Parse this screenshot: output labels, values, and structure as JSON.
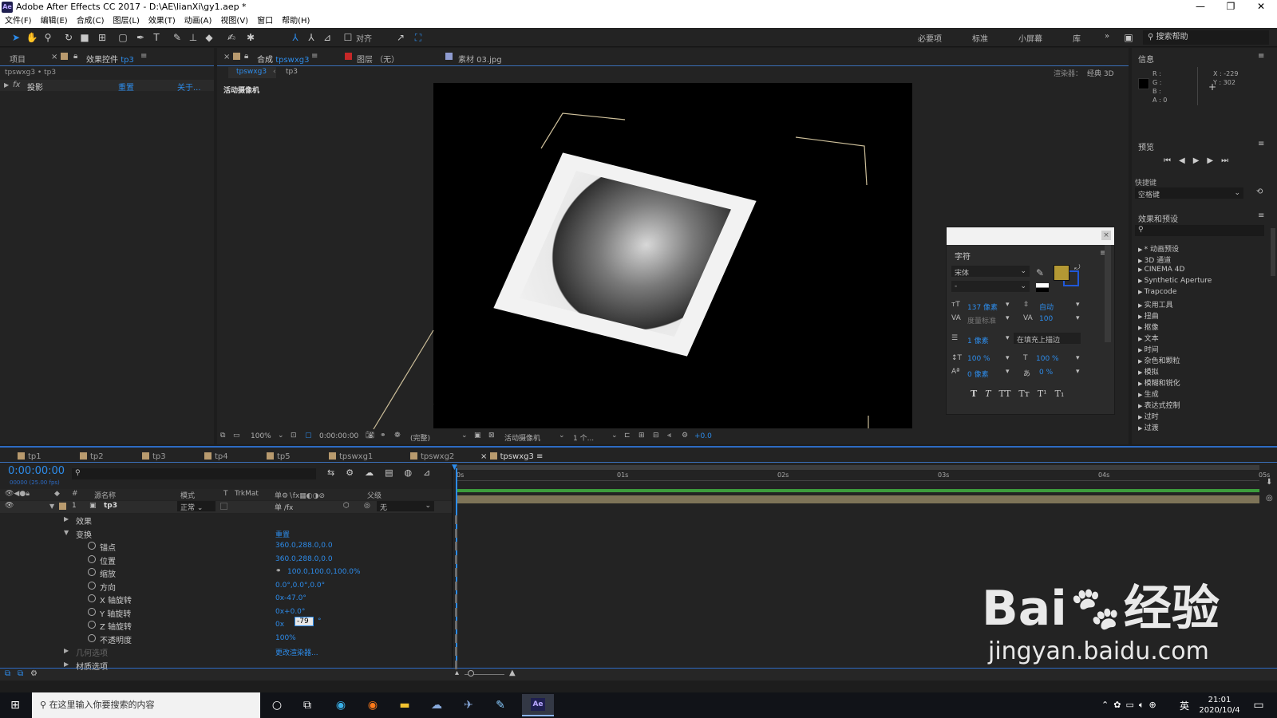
{
  "window": {
    "title": "Adobe After Effects CC 2017 - D:\\AE\\lianXi\\gy1.aep *",
    "app_icon": "Ae",
    "controls": {
      "minimize": "—",
      "maximize": "❐",
      "close": "✕"
    }
  },
  "menu": [
    "文件(F)",
    "编辑(E)",
    "合成(C)",
    "图层(L)",
    "效果(T)",
    "动画(A)",
    "视图(V)",
    "窗口",
    "帮助(H)"
  ],
  "toolbar": {
    "snap_label": "对齐",
    "workspaces": [
      "必要项",
      "标准",
      "小屏幕",
      "库"
    ],
    "more": "»",
    "search_placeholder": "搜索帮助"
  },
  "left_panel": {
    "tab_project": "项目",
    "tab_effects": "效果控件",
    "tab_effects_layer": "tp3",
    "breadcrumb": "tpswxg3 • tp3",
    "fx_name": "投影",
    "reset": "重置",
    "about": "关于..."
  },
  "comp_panel": {
    "tab_comp": "合成",
    "tab_comp_name": "tpswxg3",
    "tab_layer": "图层 （无）",
    "tab_footage": "素材 03.jpg",
    "flow_current": "tpswxg3",
    "flow_next": "tp3",
    "renderer_label": "渲染器：",
    "renderer_value": "经典 3D",
    "active_camera": "活动摄像机"
  },
  "viewer_footer": {
    "zoom": "100%",
    "timecode": "0:00:00:00",
    "resolution": "(完整)",
    "camera": "活动摄像机",
    "views": "1 个...",
    "exposure": "+0.0"
  },
  "character_panel": {
    "title": "字符",
    "font": "宋体",
    "style": "-",
    "size": "137 像素",
    "leading": "自动",
    "kerning": "度量标准",
    "tracking": "100",
    "stroke_width": "1 像素",
    "stroke_mode": "在填充上描边",
    "vscale": "100 %",
    "hscale": "100 %",
    "baseline": "0 像素",
    "tsume": "0 %",
    "styles": [
      "T",
      "T",
      "TT",
      "Tт",
      "T¹",
      "T₁"
    ],
    "fill_color": "#b39834",
    "stroke_color": "#2058d8"
  },
  "info_panel": {
    "title": "信息",
    "r": "R :",
    "g": "G :",
    "b": "B :",
    "a": "A : 0",
    "x": "X : -229",
    "y": "Y : 302"
  },
  "preview_panel": {
    "title": "预览",
    "shortcut_label": "快捷键",
    "shortcut_value": "空格键"
  },
  "effects_panel": {
    "title": "效果和预设",
    "categories": [
      "* 动画预设",
      "3D 通道",
      "CINEMA 4D",
      "Synthetic Aperture",
      "Trapcode",
      "实用工具",
      "扭曲",
      "抠像",
      "文本",
      "时间",
      "杂色和颗粒",
      "模拟",
      "模糊和锐化",
      "生成",
      "表达式控制",
      "过时",
      "过渡"
    ]
  },
  "timeline": {
    "tabs": [
      "tp1",
      "tp2",
      "tp3",
      "tp4",
      "tp5",
      "tpswxg1",
      "tpswxg2",
      "tpswxg3"
    ],
    "timecode": "0:00:00:00",
    "fps": "00000 (25.00 fps)",
    "col_num": "#",
    "col_source": "源名称",
    "col_mode": "模式",
    "col_t": "T",
    "col_trkmat": "TrkMat",
    "col_parent": "父级",
    "layer_num": "1",
    "layer_name": "tp3",
    "layer_mode": "正常",
    "layer_parent": "无",
    "ruler": [
      "0s",
      "01s",
      "02s",
      "03s",
      "04s",
      "05s"
    ],
    "props": [
      {
        "name": "效果",
        "value": ""
      },
      {
        "name": "变换",
        "value": "重置"
      },
      {
        "name": "锚点",
        "value": "360.0,288.0,0.0"
      },
      {
        "name": "位置",
        "value": "360.0,288.0,0.0"
      },
      {
        "name": "缩放",
        "value": "100.0,100.0,100.0%"
      },
      {
        "name": "方向",
        "value": "0.0°,0.0°,0.0°"
      },
      {
        "name": "X 轴旋转",
        "value": "0x-47.0°"
      },
      {
        "name": "Y 轴旋转",
        "value": "0x+0.0°"
      },
      {
        "name": "Z 轴旋转",
        "value": "0x"
      },
      {
        "name": "不透明度",
        "value": "100%"
      },
      {
        "name": "几何选项",
        "value": "更改渲染器..."
      },
      {
        "name": "材质选项",
        "value": ""
      }
    ],
    "z_rotation_editing": "-79",
    "z_unit": "°"
  },
  "taskbar": {
    "search_placeholder": "在这里输入你要搜索的内容",
    "time": "21:01",
    "date": "2020/10/4",
    "ime": "英"
  },
  "watermark": {
    "brand": "Bai",
    "brand2": "经验",
    "url": "jingyan.baidu.com"
  }
}
